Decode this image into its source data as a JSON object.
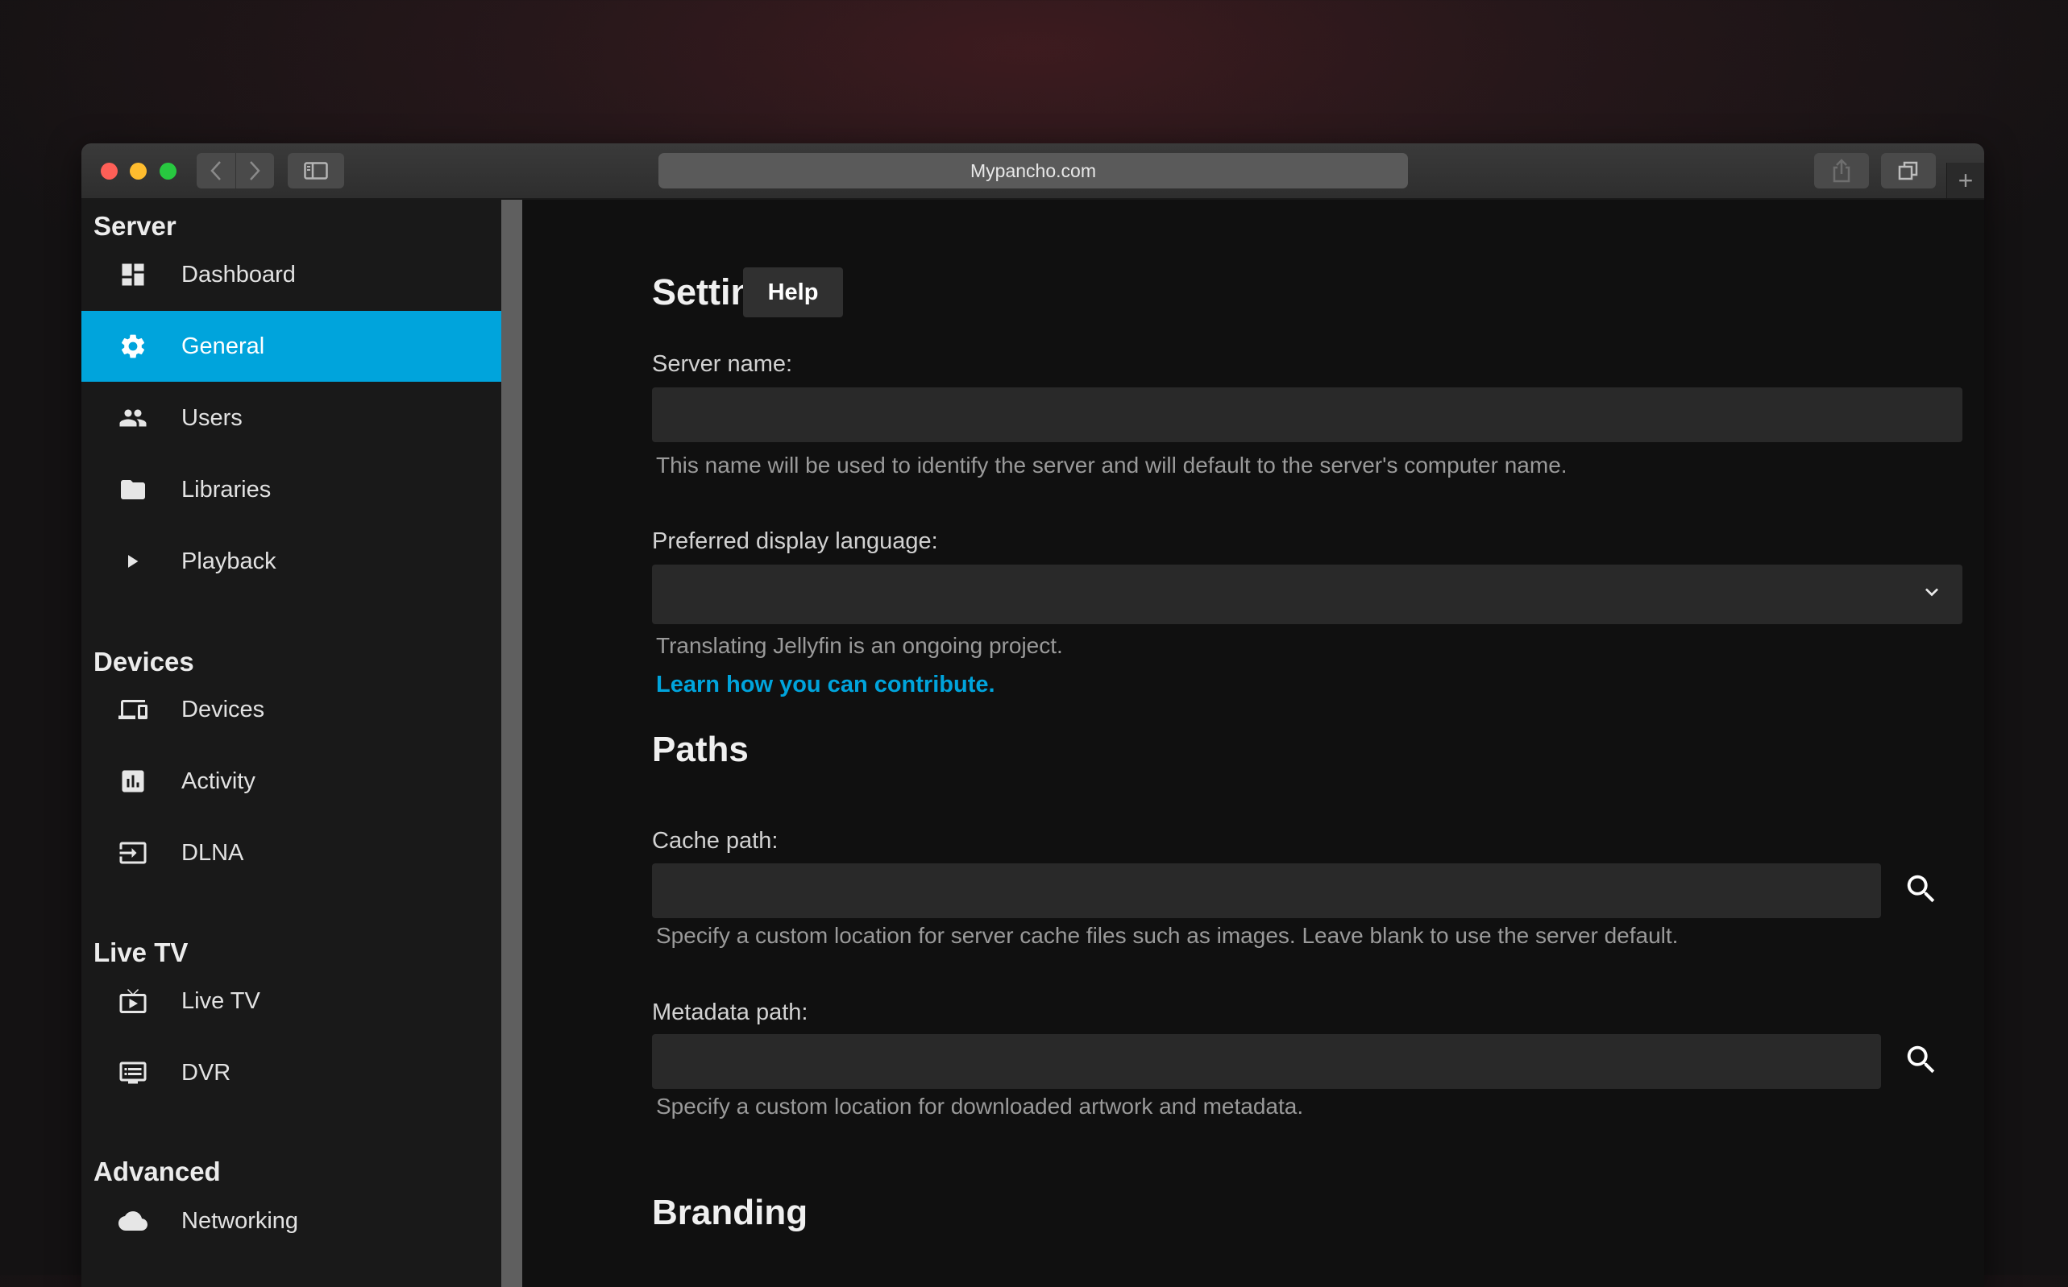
{
  "browser": {
    "address": "Mypancho.com",
    "new_tab_label": "+"
  },
  "sidebar": {
    "sections": [
      {
        "title": "Server",
        "items": [
          {
            "label": "Dashboard",
            "icon": "dashboard-icon"
          },
          {
            "label": "General",
            "icon": "gear-icon",
            "active": true
          },
          {
            "label": "Users",
            "icon": "users-icon"
          },
          {
            "label": "Libraries",
            "icon": "folder-icon"
          },
          {
            "label": "Playback",
            "icon": "play-icon"
          }
        ]
      },
      {
        "title": "Devices",
        "items": [
          {
            "label": "Devices",
            "icon": "devices-icon"
          },
          {
            "label": "Activity",
            "icon": "activity-icon"
          },
          {
            "label": "DLNA",
            "icon": "input-icon"
          }
        ]
      },
      {
        "title": "Live TV",
        "items": [
          {
            "label": "Live TV",
            "icon": "live-tv-icon"
          },
          {
            "label": "DVR",
            "icon": "dvr-icon"
          }
        ]
      },
      {
        "title": "Advanced",
        "items": [
          {
            "label": "Networking",
            "icon": "cloud-icon"
          }
        ]
      }
    ],
    "active_color": "#00a4dc"
  },
  "main": {
    "title": "Settings",
    "help_label": "Help",
    "server_name": {
      "label": "Server name:",
      "value": "",
      "hint": "This name will be used to identify the server and will default to the server's computer name."
    },
    "language": {
      "label": "Preferred display language:",
      "value": "",
      "hint": "Translating Jellyfin is an ongoing project.",
      "link": "Learn how you can contribute."
    },
    "paths_title": "Paths",
    "cache_path": {
      "label": "Cache path:",
      "value": "",
      "hint": "Specify a custom location for server cache files such as images. Leave blank to use the server default."
    },
    "metadata_path": {
      "label": "Metadata path:",
      "value": "",
      "hint": "Specify a custom location for downloaded artwork and metadata."
    },
    "branding_title": "Branding"
  }
}
